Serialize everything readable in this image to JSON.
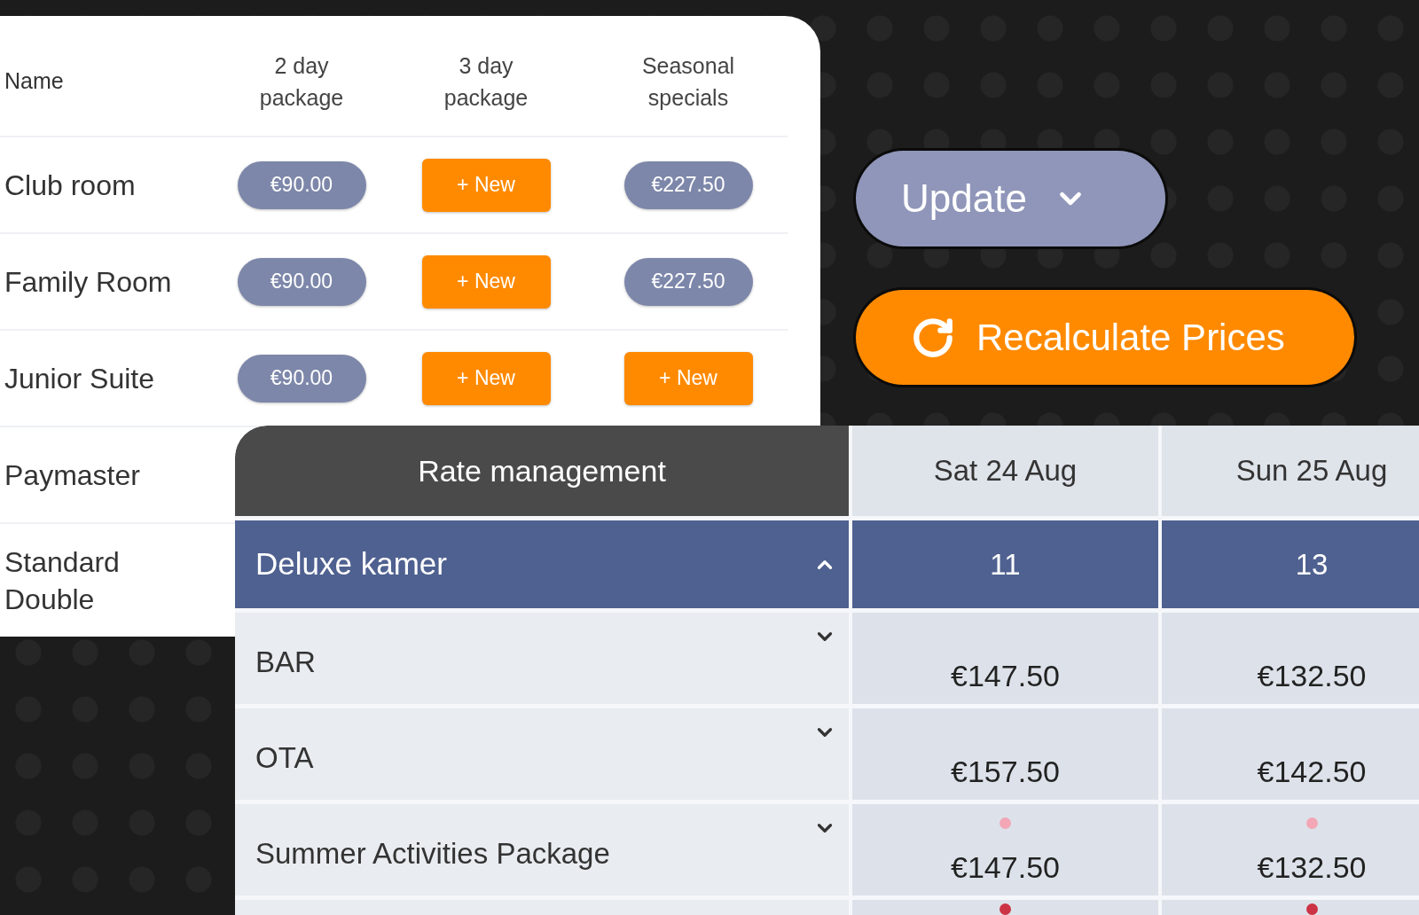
{
  "packages_table": {
    "columns": [
      "Name",
      "2 day package",
      "3 day package",
      "Seasonal specials"
    ],
    "rows": [
      {
        "name": "Club room",
        "cells": [
          {
            "kind": "price",
            "text": "€90.00"
          },
          {
            "kind": "new",
            "text": "+ New"
          },
          {
            "kind": "price",
            "text": "€227.50"
          }
        ]
      },
      {
        "name": "Family Room",
        "cells": [
          {
            "kind": "price",
            "text": "€90.00"
          },
          {
            "kind": "new",
            "text": "+ New"
          },
          {
            "kind": "price",
            "text": "€227.50"
          }
        ]
      },
      {
        "name": "Junior Suite",
        "cells": [
          {
            "kind": "price",
            "text": "€90.00"
          },
          {
            "kind": "new",
            "text": "+ New"
          },
          {
            "kind": "new",
            "text": "+ New"
          }
        ]
      },
      {
        "name": "Paymaster"
      },
      {
        "name": "Standard Double"
      }
    ]
  },
  "actions": [
    {
      "kind": "dropdown",
      "label": "Update"
    },
    {
      "kind": "refresh",
      "label": "Recalculate Prices"
    }
  ],
  "rate_management": {
    "title": "Rate management",
    "dates": [
      "Sat 24 Aug",
      "Sun 25 Aug"
    ],
    "rows": [
      {
        "kind": "group",
        "name": "Deluxe kamer",
        "expanded": true,
        "values": [
          "11",
          "13"
        ]
      },
      {
        "kind": "rate",
        "name": "BAR",
        "expanded": false,
        "cells": [
          {
            "price": "€147.50"
          },
          {
            "price": "€132.50"
          }
        ]
      },
      {
        "kind": "rate",
        "name": "OTA",
        "expanded": false,
        "cells": [
          {
            "price": "€157.50"
          },
          {
            "price": "€142.50"
          }
        ]
      },
      {
        "kind": "rate",
        "name": "Summer Activities Package",
        "expanded": false,
        "cells": [
          {
            "price": "€147.50",
            "color": "#f3a6b6"
          },
          {
            "price": "€132.50",
            "color": "#f3a6b6"
          }
        ]
      },
      {
        "kind": "rate",
        "cells": [
          {
            "color": "#cc3344"
          },
          {
            "color": "#cc3344"
          }
        ]
      }
    ]
  }
}
